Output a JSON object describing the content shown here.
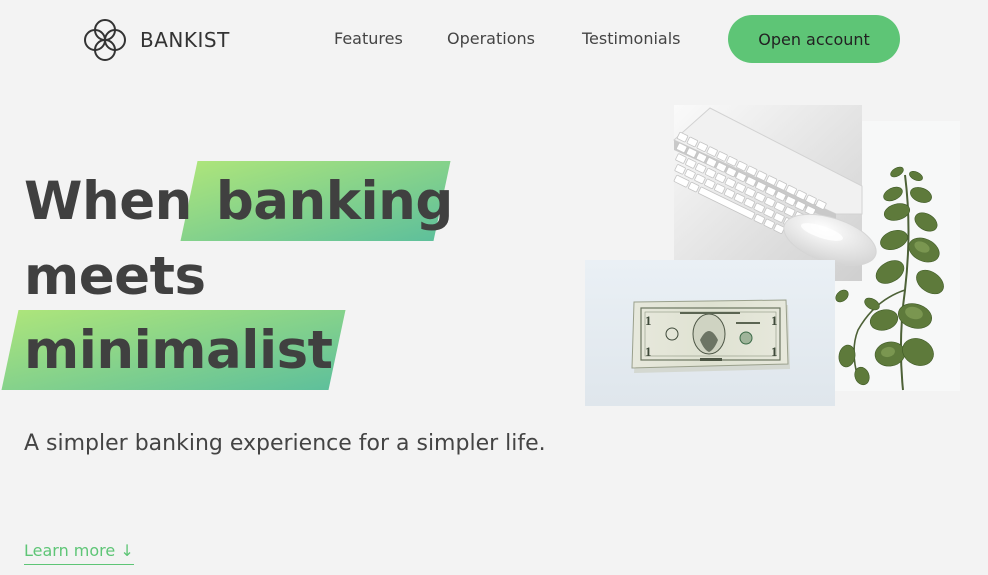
{
  "brand": {
    "name": "BANKIST"
  },
  "nav": {
    "links": [
      {
        "label": "Features"
      },
      {
        "label": "Operations"
      },
      {
        "label": "Testimonials"
      }
    ],
    "cta_label": "Open account"
  },
  "hero": {
    "heading_line1_prefix": "When",
    "heading_highlight1": "banking",
    "heading_line2": "meets",
    "heading_highlight2": "minimalist",
    "subtitle": "A simpler banking experience for a simpler life.",
    "learn_more": "Learn more ↓"
  },
  "colors": {
    "accent": "#5ec576",
    "background": "#f3f3f3",
    "text": "#444444",
    "gradient_start": "#39b385",
    "gradient_end": "#9be15d"
  },
  "icons": {
    "logo": "bankist-logo-icon"
  }
}
